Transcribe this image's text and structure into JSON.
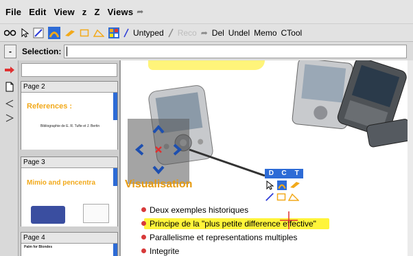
{
  "menubar": {
    "items": [
      "File",
      "Edit",
      "View",
      "z",
      "Z",
      "Views"
    ]
  },
  "toolbar": {
    "text_buttons": {
      "untyped": "Untyped",
      "reco": "Reco",
      "del": "Del",
      "undel": "Undel",
      "memo": "Memo",
      "ctool": "CTool"
    }
  },
  "selection": {
    "minus": "-",
    "label": "Selection:",
    "value": ""
  },
  "pages": [
    {
      "label": "Page 2",
      "title": "References :",
      "snippet": "Bibliographie de E. R. Tufte et J. Bertin"
    },
    {
      "label": "Page 3",
      "title": "Mimio and pencentra"
    },
    {
      "label": "Page 4",
      "snippet": "Palm for Blondes"
    }
  ],
  "slide": {
    "heading": "Visualisation",
    "bullets": [
      "Deux exemples historiques",
      "Principe de la \"plus petite difference effective\"",
      "Parallelisme et representations multiples",
      "Integrite"
    ],
    "dct": [
      "D",
      "C",
      "T"
    ]
  },
  "colors": {
    "accent_orange": "#f2a91a",
    "highlight_yellow": "#fff43a",
    "bullet_red": "#d73a3a",
    "dct_blue": "#2d6bd6"
  }
}
